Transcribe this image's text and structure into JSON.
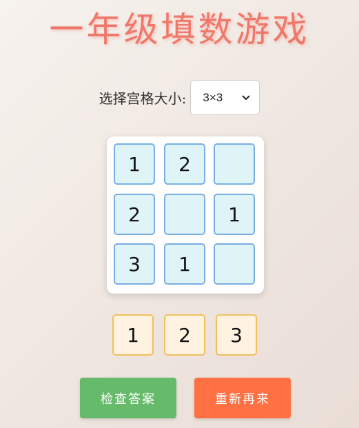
{
  "title": "一年级填数游戏",
  "size": {
    "label": "选择宫格大小:",
    "selected": "3×3"
  },
  "grid": {
    "cells": [
      [
        "1",
        "2",
        ""
      ],
      [
        "2",
        "",
        "1"
      ],
      [
        "3",
        "1",
        ""
      ]
    ]
  },
  "choices": [
    "1",
    "2",
    "3"
  ],
  "buttons": {
    "check": "检查答案",
    "reset": "重新再来"
  },
  "colors": {
    "title": "#f0786a",
    "cell_border": "#7aaee6",
    "cell_bg": "#def4f6",
    "choice_border": "#f2bf5e",
    "choice_bg": "#fff2e0",
    "check_button": "#66bb6a",
    "reset_button": "#ff7043"
  }
}
